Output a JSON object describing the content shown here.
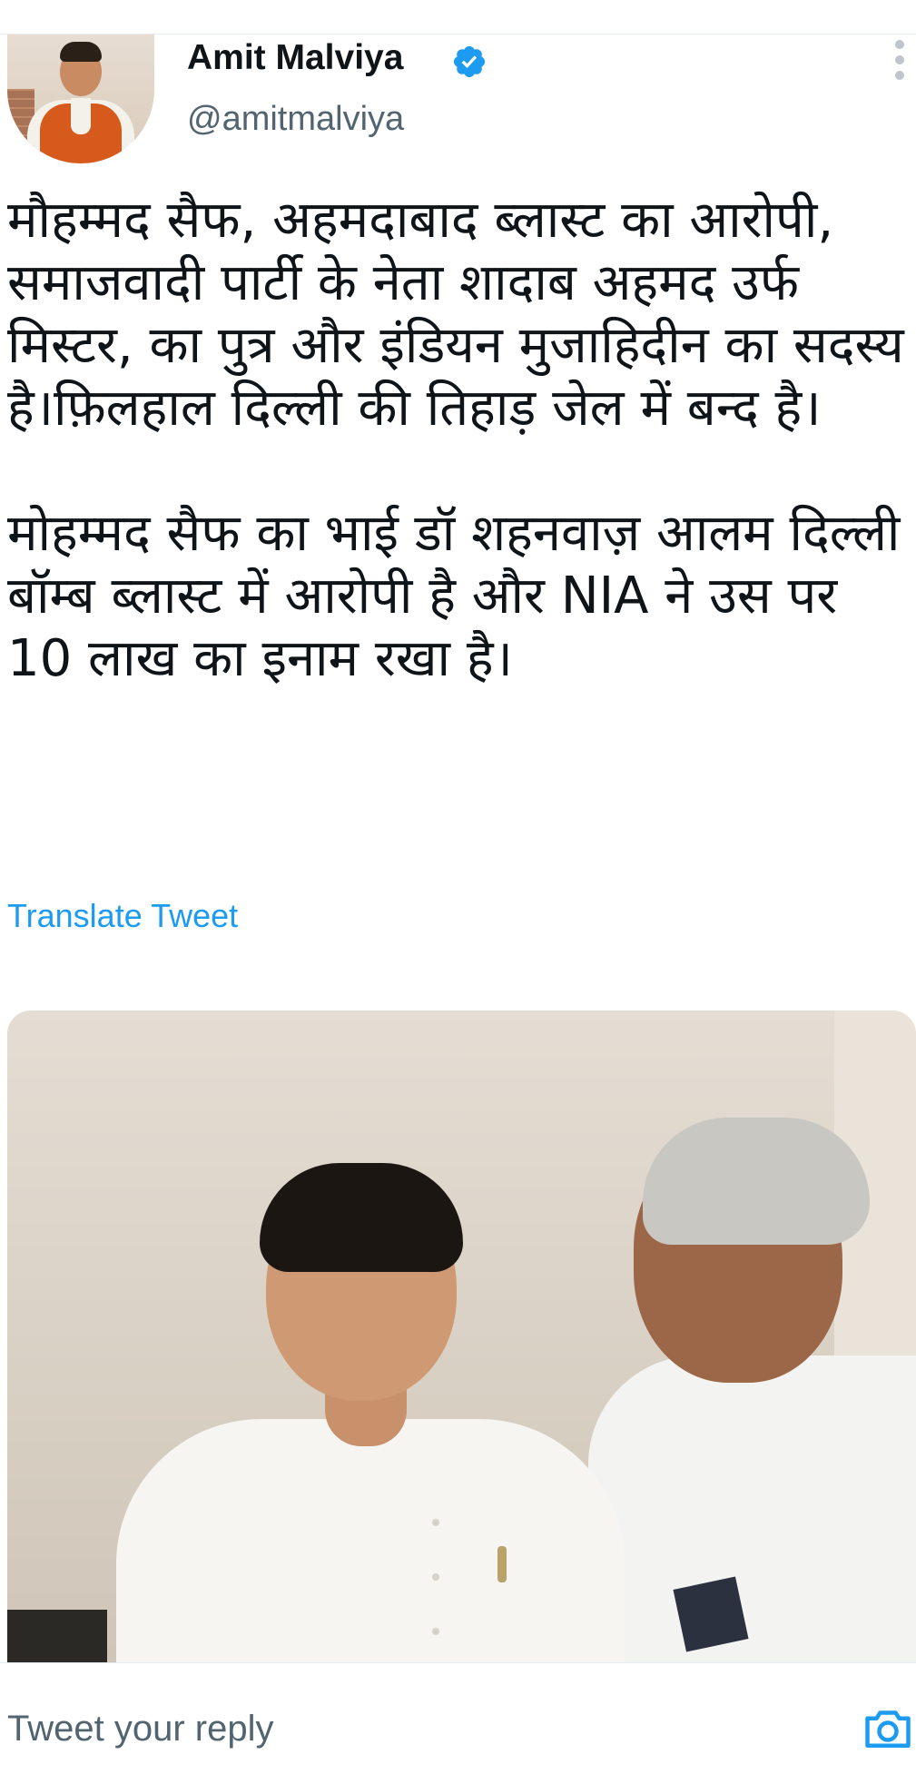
{
  "author": {
    "name": "Amit Malviya",
    "handle": "@amitmalviya",
    "verified": true
  },
  "tweet": {
    "paragraphs": [
      "मौहम्मद सैफ, अहमदाबाद ब्लास्ट का आरोपी, समाजवादी पार्टी के नेता शादाब अहमद उर्फ मिस्टर, का पुत्र और इंडियन मुजाहिदीन का सदस्य है।फ़िलहाल दिल्ली की तिहाड़ जेल में बन्द है।",
      "मोहम्मद सैफ का भाई डॉ शहनवाज़ आलम दिल्ली बॉम्ब ब्लास्ट में आरोपी है और NIA ने उस पर 10 लाख का इनाम रखा है।"
    ],
    "translate_label": "Translate Tweet"
  },
  "reply": {
    "placeholder": "Tweet your reply"
  },
  "colors": {
    "link": "#1d9bf0",
    "verified_badge": "#1d9bf0",
    "secondary_text": "#536471",
    "primary_text": "#0f1419"
  },
  "icons": [
    "verified-badge-icon",
    "more-options-icon",
    "camera-icon"
  ]
}
